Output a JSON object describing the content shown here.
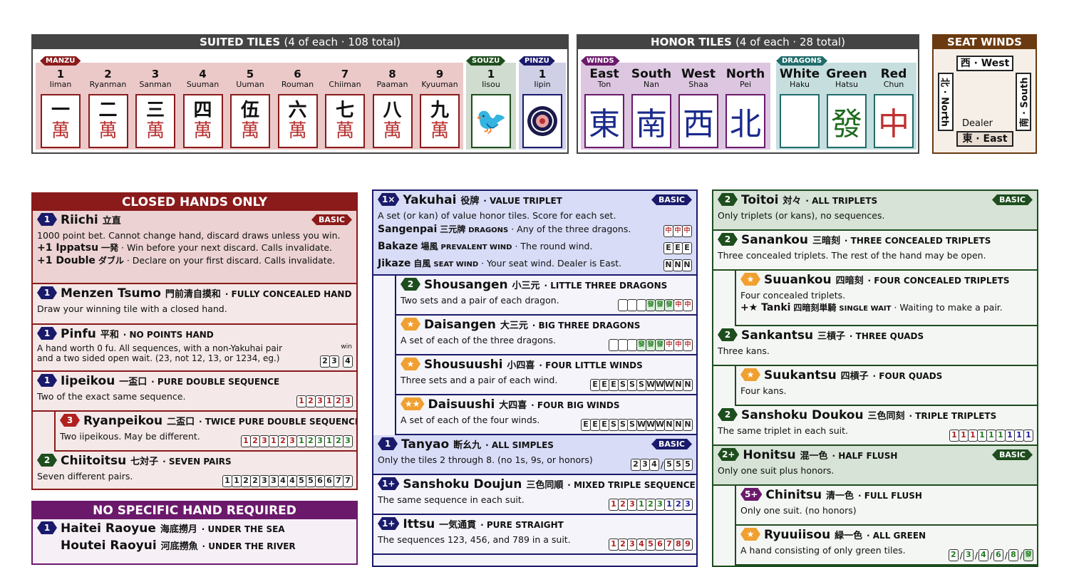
{
  "suited": {
    "header": "SUITED TILES",
    "header_sub": "(4 of each · 108 total)",
    "manzu_label": "MANZU",
    "souzu_label": "SOUZU",
    "pinzu_label": "PINZU",
    "manzu": [
      {
        "num": "1",
        "name": "Iiman",
        "glyph": "一"
      },
      {
        "num": "2",
        "name": "Ryanman",
        "glyph": "二"
      },
      {
        "num": "3",
        "name": "Sanman",
        "glyph": "三"
      },
      {
        "num": "4",
        "name": "Suuman",
        "glyph": "四"
      },
      {
        "num": "5",
        "name": "Uuman",
        "glyph": "伍"
      },
      {
        "num": "6",
        "name": "Rouman",
        "glyph": "六"
      },
      {
        "num": "7",
        "name": "Chiiman",
        "glyph": "七"
      },
      {
        "num": "8",
        "name": "Paaman",
        "glyph": "八"
      },
      {
        "num": "9",
        "name": "Kyuuman",
        "glyph": "九"
      }
    ],
    "man_char": "萬",
    "souzu": {
      "num": "1",
      "name": "Iisou",
      "glyph": "🐦"
    },
    "pinzu": {
      "num": "1",
      "name": "Iipin",
      "glyph": "◎"
    }
  },
  "honor": {
    "header": "HONOR TILES",
    "header_sub": "(4 of each · 28 total)",
    "winds_label": "WINDS",
    "dragons_label": "DRAGONS",
    "winds": [
      {
        "name": "East",
        "jp": "Ton",
        "glyph": "東"
      },
      {
        "name": "South",
        "jp": "Nan",
        "glyph": "南"
      },
      {
        "name": "West",
        "jp": "Shaa",
        "glyph": "西"
      },
      {
        "name": "North",
        "jp": "Pei",
        "glyph": "北"
      }
    ],
    "dragons": [
      {
        "name": "White",
        "jp": "Haku",
        "glyph": ""
      },
      {
        "name": "Green",
        "jp": "Hatsu",
        "glyph": "發"
      },
      {
        "name": "Red",
        "jp": "Chun",
        "glyph": "中"
      }
    ]
  },
  "seat_winds": {
    "header": "SEAT WINDS",
    "west": "西 · West",
    "north": "北 · North",
    "south": "南 · South",
    "east": "東 · East",
    "dealer": "Dealer"
  },
  "closed": {
    "header": "CLOSED HANDS ONLY",
    "riichi": {
      "han": "1",
      "name": "Riichi",
      "jp": "立直",
      "badge": "BASIC",
      "desc": "1000 point bet. Cannot change hand, discard draws unless you win.",
      "ippatsu_b": "+1 Ippatsu",
      "ippatsu_jp": "一発",
      "ippatsu_d": " · Win before your next discard. Calls invalidate.",
      "double_b": "+1 Double",
      "double_jp": "ダブル",
      "double_d": " · Declare on your first discard. Calls invalidate."
    },
    "menzen": {
      "han": "1",
      "name": "Menzen Tsumo",
      "jp": "門前清自摸和",
      "en": "· FULLY CONCEALED HAND",
      "desc": "Draw your winning tile with a closed hand."
    },
    "pinfu": {
      "han": "1",
      "name": "Pinfu",
      "jp": "平和",
      "en": "· NO POINTS HAND",
      "desc1": "A hand worth 0 fu. All sequences, with a non-Yakuhai pair",
      "desc2": "and a two sided open wait. (23, not 12, 13, or 1234, eg.)",
      "win": "win",
      "tiles": [
        "2",
        "3"
      ],
      "win_tile": "4"
    },
    "iipeikou": {
      "han": "1",
      "name": "Iipeikou",
      "jp": "一盃口",
      "en": "· PURE DOUBLE SEQUENCE",
      "desc": "Two of the exact same sequence.",
      "tiles": [
        "1",
        "2",
        "3",
        "1",
        "2",
        "3"
      ]
    },
    "ryanpeikou": {
      "han": "3",
      "name": "Ryanpeikou",
      "jp": "二盃口",
      "en": "· TWICE PURE DOUBLE SEQUENCE",
      "desc": "Two iipeikous. May be different.",
      "tiles": [
        "1",
        "2",
        "3",
        "1",
        "2",
        "3",
        "1",
        "2",
        "3",
        "1",
        "2",
        "3"
      ]
    },
    "chiitoitsu": {
      "han": "2",
      "name": "Chiitoitsu",
      "jp": "七対子",
      "en": "· SEVEN PAIRS",
      "desc": "Seven different pairs.",
      "tiles": [
        "1",
        "1",
        "2",
        "2",
        "3",
        "3",
        "4",
        "4",
        "5",
        "5",
        "6",
        "6",
        "7",
        "7"
      ]
    }
  },
  "nospecific": {
    "header": "NO SPECIFIC HAND REQUIRED",
    "haitei": {
      "han": "1",
      "name": "Haitei Raoyue",
      "jp": "海底撈月",
      "en": "· UNDER THE SEA",
      "name2": "Houtei Raoyui",
      "jp2": "河底撈魚",
      "en2": "· UNDER THE RIVER"
    }
  },
  "yakuhai": {
    "han": "1×",
    "name": "Yakuhai",
    "jp": "役牌",
    "en": "· VALUE TRIPLET",
    "badge": "BASIC",
    "desc": "A set (or kan) of value honor tiles. Score for each set.",
    "subs": [
      {
        "name": "Sangenpai",
        "jp": "三元牌",
        "en": "DRAGONS",
        "desc": " · Any of the three dragons.",
        "tiles": [
          "中",
          "中",
          "中"
        ]
      },
      {
        "name": "Bakaze",
        "jp": "場風",
        "en": "PREVALENT WIND",
        "desc": " · The round wind.",
        "tiles": [
          "E",
          "E",
          "E"
        ]
      },
      {
        "name": "Jikaze",
        "jp": "自風",
        "en": "SEAT WIND",
        "desc": " · Your seat wind. Dealer is East.",
        "tiles": [
          "N",
          "N",
          "N"
        ]
      }
    ]
  },
  "mid": {
    "shousangen": {
      "han": "2",
      "name": "Shousangen",
      "jp": "小三元",
      "en": "· LITTLE THREE DRAGONS",
      "desc": "Two sets and a pair of each dragon.",
      "tiles": [
        "",
        "",
        "",
        "發",
        "發",
        "發",
        "中",
        "中"
      ]
    },
    "daisangen": {
      "han": "★",
      "name": "Daisangen",
      "jp": "大三元",
      "en": "· BIG THREE DRAGONS",
      "desc": "A set of each of the three dragons.",
      "tiles": [
        "",
        "",
        "",
        "發",
        "發",
        "發",
        "中",
        "中",
        "中"
      ]
    },
    "shousuushi": {
      "han": "★",
      "name": "Shousuushi",
      "jp": "小四喜",
      "en": "· FOUR LITTLE WINDS",
      "desc": "Three sets and a pair of each wind.",
      "tiles": [
        "E",
        "E",
        "E",
        "S",
        "S",
        "S",
        "W",
        "W",
        "W",
        "N",
        "N"
      ]
    },
    "daisuushi": {
      "han": "★★",
      "name": "Daisuushi",
      "jp": "大四喜",
      "en": "· FOUR BIG WINDS",
      "desc": "A set of each of the four winds.",
      "tiles": [
        "E",
        "E",
        "E",
        "S",
        "S",
        "S",
        "W",
        "W",
        "W",
        "N",
        "N",
        "N"
      ]
    },
    "tanyao": {
      "han": "1",
      "name": "Tanyao",
      "jp": "断幺九",
      "en": "· ALL SIMPLES",
      "badge": "BASIC",
      "desc": "Only the tiles 2 through 8. (no 1s, 9s, or honors)",
      "tiles_a": [
        "2",
        "3",
        "4"
      ],
      "tiles_b": [
        "5",
        "5",
        "5"
      ]
    },
    "doujun": {
      "han": "1+",
      "name": "Sanshoku Doujun",
      "jp": "三色同順",
      "en": "· MIXED TRIPLE SEQUENCE",
      "desc": "The same sequence in each suit.",
      "tiles": [
        "1",
        "2",
        "3",
        "1",
        "2",
        "3",
        "1",
        "2",
        "3"
      ]
    },
    "ittsu": {
      "han": "1+",
      "name": "Ittsu",
      "jp": "一気通貫",
      "en": "· PURE STRAIGHT",
      "desc": "The sequences 123, 456, and 789 in a suit.",
      "tiles": [
        "1",
        "2",
        "3",
        "4",
        "5",
        "6",
        "7",
        "8",
        "9"
      ]
    }
  },
  "right": {
    "toitoi": {
      "han": "2",
      "name": "Toitoi",
      "jp": "対々",
      "en": "· ALL TRIPLETS",
      "badge": "BASIC",
      "desc": "Only triplets (or kans), no sequences."
    },
    "sanankou": {
      "han": "2",
      "name": "Sanankou",
      "jp": "三暗刻",
      "en": "· THREE CONCEALED TRIPLETS",
      "desc": "Three concealed triplets. The rest of the hand may be open."
    },
    "suuankou": {
      "han": "★",
      "name": "Suuankou",
      "jp": "四暗刻",
      "en": "· FOUR CONCEALED TRIPLETS",
      "desc": "Four concealed triplets.",
      "tanki_b": "+★ Tanki",
      "tanki_jp": "四暗刻単騎",
      "tanki_en": "SINGLE WAIT",
      "tanki_d": " · Waiting to make a pair."
    },
    "sankantsu": {
      "han": "2",
      "name": "Sankantsu",
      "jp": "三槓子",
      "en": "· THREE QUADS",
      "desc": "Three kans."
    },
    "suukantsu": {
      "han": "★",
      "name": "Suukantsu",
      "jp": "四槓子",
      "en": "· FOUR QUADS",
      "desc": "Four kans."
    },
    "doukou": {
      "han": "2",
      "name": "Sanshoku Doukou",
      "jp": "三色同刻",
      "en": "· TRIPLE TRIPLETS",
      "desc": "The same triplet in each suit.",
      "tiles": [
        "1",
        "1",
        "1",
        "1",
        "1",
        "1",
        "1",
        "1",
        "1"
      ]
    },
    "honitsu": {
      "han": "2+",
      "name": "Honitsu",
      "jp": "混一色",
      "en": "· HALF FLUSH",
      "badge": "BASIC",
      "desc": "Only one suit plus honors."
    },
    "chinitsu": {
      "han": "5+",
      "name": "Chinitsu",
      "jp": "清一色",
      "en": "· FULL FLUSH",
      "desc": "Only one suit. (no honors)"
    },
    "ryuuiisou": {
      "han": "★",
      "name": "Ryuuiisou",
      "jp": "緑一色",
      "en": "· ALL GREEN",
      "desc": "A hand consisting of only green tiles.",
      "tiles": [
        "2",
        "3",
        "4",
        "6",
        "8",
        "發"
      ]
    }
  },
  "colors": {
    "red": "#8b1a1a",
    "navy": "#1a1a6b",
    "green": "#1e4d1e",
    "purple": "#6b1a6b",
    "orange": "#f0a030",
    "brown": "#6b3a10"
  }
}
